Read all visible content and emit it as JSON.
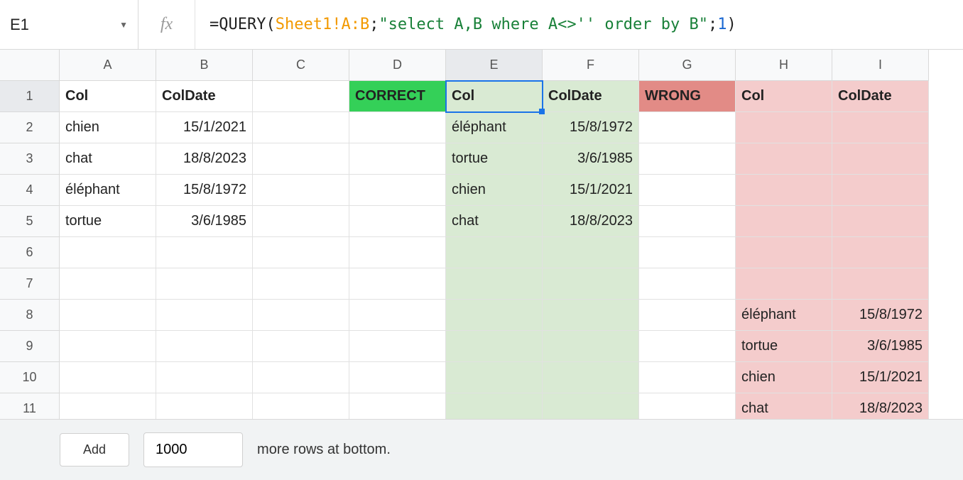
{
  "nameBox": {
    "ref": "E1"
  },
  "fxLabel": "fx",
  "formula": {
    "prefix": "=",
    "fn": "QUERY",
    "open": "(",
    "range": "Sheet1!A:B",
    "sep1": ";",
    "str": "\"select A,B where A<>'' order by B\"",
    "sep2": ";",
    "num": "1",
    "close": ")"
  },
  "columnLetters": [
    "A",
    "B",
    "C",
    "D",
    "E",
    "F",
    "G",
    "H",
    "I"
  ],
  "rowNumbers": [
    "1",
    "2",
    "3",
    "4",
    "5",
    "6",
    "7",
    "8",
    "9",
    "10",
    "11"
  ],
  "activeCol": "E",
  "activeRow": "1",
  "cells": {
    "A1": "Col",
    "B1": "ColDate",
    "A2": "chien",
    "B2": "15/1/2021",
    "A3": "chat",
    "B3": "18/8/2023",
    "A4": "éléphant",
    "B4": "15/8/1972",
    "A5": "tortue",
    "B5": "3/6/1985",
    "D1": "CORRECT",
    "E1": "Col",
    "F1": "ColDate",
    "E2": "éléphant",
    "F2": "15/8/1972",
    "E3": "tortue",
    "F3": "3/6/1985",
    "E4": "chien",
    "F4": "15/1/2021",
    "E5": "chat",
    "F5": "18/8/2023",
    "G1": "WRONG",
    "H1": "Col",
    "I1": "ColDate",
    "H8": "éléphant",
    "I8": "15/8/1972",
    "H9": "tortue",
    "I9": "3/6/1985",
    "H10": "chien",
    "I10": "15/1/2021",
    "H11": "chat",
    "I11": "18/8/2023"
  },
  "footer": {
    "addLabel": "Add",
    "rowsValue": "1000",
    "moreRows": "more rows at bottom."
  }
}
